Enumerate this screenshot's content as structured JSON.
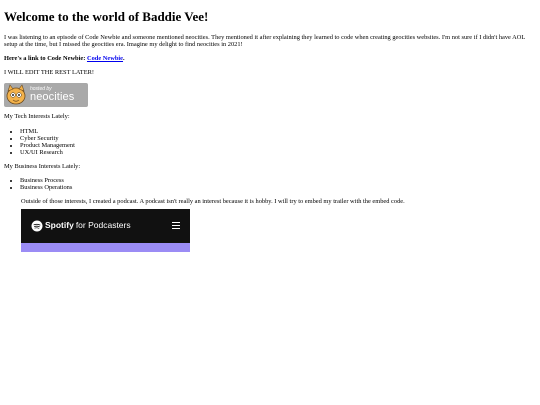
{
  "page": {
    "title": "Welcome to the world of Baddie Vee!",
    "intro": "I was listening to an episode of Code Newbie and someone mentioned neocities. They mentioned it after explaining they learned to code when creating geocities websites. I'm not sure if I didn't have AOL setup at the time, but I missed the geocities era. Imagine my delight to find neocities in 2021!",
    "link_prefix": "Here's a link to Code Newbie:",
    "link_text": "Code Newbie",
    "link_suffix": ".",
    "edit_note": "I WILL EDIT THE REST LATER!"
  },
  "badge": {
    "small_text": "hosted by",
    "big_text": "neocities",
    "bg_color": "#a9a9a9"
  },
  "tech": {
    "heading": "My Tech Interests Lately:",
    "items": [
      "HTML",
      "Cyber Security",
      "Product Management",
      "UX/UI Research"
    ]
  },
  "business": {
    "heading": "My Business Interests Lately:",
    "items": [
      "Business Process",
      "Business Operations"
    ]
  },
  "podcast": {
    "text": "Outside of those interests, I created a podcast. A podcast isn't really an interest because it is hobby. I will try to embed my trailer with the embed code."
  },
  "spotify": {
    "brand": "Spotify",
    "sub": "for Podcasters",
    "top_color": "#111111",
    "bottom_color": "#9b8cf5",
    "logo_icon": "spotify-icon",
    "menu_icon": "hamburger-menu-icon"
  }
}
